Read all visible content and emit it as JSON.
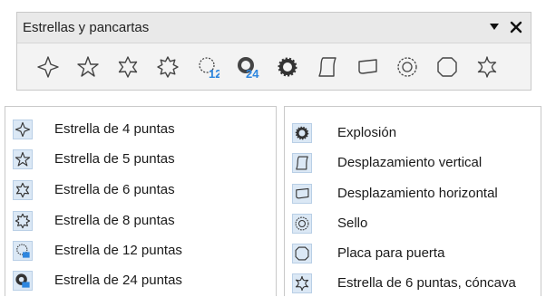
{
  "toolbar": {
    "title": "Estrellas y pancartas",
    "icons": [
      {
        "name": "star-4-icon"
      },
      {
        "name": "star-5-icon"
      },
      {
        "name": "star-6-icon"
      },
      {
        "name": "star-8-icon"
      },
      {
        "name": "star-12-icon",
        "badge": "12"
      },
      {
        "name": "star-24-icon",
        "badge": "24"
      },
      {
        "name": "explosion-icon"
      },
      {
        "name": "vertical-scroll-icon"
      },
      {
        "name": "horizontal-scroll-icon"
      },
      {
        "name": "seal-icon"
      },
      {
        "name": "door-plate-icon"
      },
      {
        "name": "concave-6-star-icon"
      }
    ],
    "accent": "#2e86de"
  },
  "menu_left": [
    {
      "label": "Estrella de 4 puntas",
      "icon": "star-4-icon"
    },
    {
      "label": "Estrella de 5 puntas",
      "icon": "star-5-icon"
    },
    {
      "label": "Estrella de 6 puntas",
      "icon": "star-6-icon"
    },
    {
      "label": "Estrella de 8 puntas",
      "icon": "star-8-icon"
    },
    {
      "label": "Estrella de 12 puntas",
      "icon": "star-12-icon"
    },
    {
      "label": "Estrella de 24 puntas",
      "icon": "star-24-icon"
    }
  ],
  "menu_right": [
    {
      "label": "Explosión",
      "icon": "explosion-icon"
    },
    {
      "label": "Desplazamiento vertical",
      "icon": "vertical-scroll-icon"
    },
    {
      "label": "Desplazamiento horizontal",
      "icon": "horizontal-scroll-icon"
    },
    {
      "label": "Sello",
      "icon": "seal-icon"
    },
    {
      "label": "Placa para puerta",
      "icon": "door-plate-icon"
    },
    {
      "label": "Estrella de 6 puntas, cóncava",
      "icon": "concave-6-star-icon"
    }
  ]
}
